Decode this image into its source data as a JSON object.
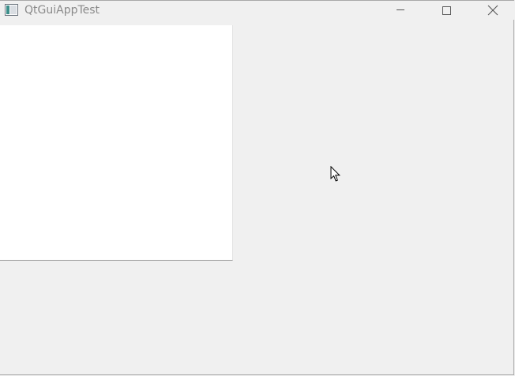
{
  "window": {
    "title": "QtGuiAppTest"
  },
  "titlebar": {
    "controls": [
      {
        "name": "minimize",
        "icon": "minimize-icon"
      },
      {
        "name": "maximize",
        "icon": "maximize-icon"
      },
      {
        "name": "close",
        "icon": "close-icon"
      }
    ]
  },
  "colors": {
    "background": "#f0f0f0",
    "panel": "#ffffff",
    "title_text": "#8a8a8a"
  }
}
